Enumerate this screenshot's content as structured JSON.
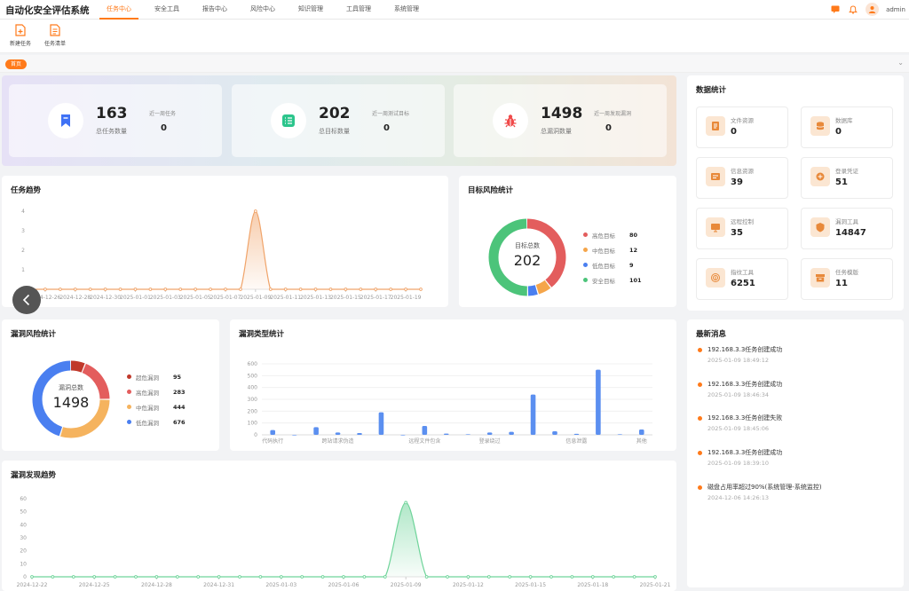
{
  "app": {
    "title": "自动化安全评估系统"
  },
  "nav": {
    "items": [
      "任务中心",
      "安全工具",
      "报告中心",
      "风险中心",
      "知识管理",
      "工具管理",
      "系统管理"
    ],
    "active": 0
  },
  "user": {
    "name": "admin"
  },
  "toolbar": {
    "new_task": "新建任务",
    "task_list": "任务清单"
  },
  "tabs": {
    "current": "首页"
  },
  "stats": [
    {
      "icon": "bookmark-icon",
      "value": "163",
      "label": "总任务数量",
      "sub_label": "近一周任务",
      "sub_value": "0",
      "color": "#3f72f5"
    },
    {
      "icon": "list-icon",
      "value": "202",
      "label": "总目标数量",
      "sub_label": "近一周测试目标",
      "sub_value": "0",
      "color": "#2cc58c"
    },
    {
      "icon": "bug-icon",
      "value": "1498",
      "label": "总漏洞数量",
      "sub_label": "近一周发现漏洞",
      "sub_value": "0",
      "color": "#f04a4a"
    }
  ],
  "data_stats": {
    "title": "数据统计",
    "items": [
      {
        "icon": "file-asset-icon",
        "label": "文件资源",
        "value": "0"
      },
      {
        "icon": "database-icon",
        "label": "数据库",
        "value": "0"
      },
      {
        "icon": "info-asset-icon",
        "label": "信息资源",
        "value": "39"
      },
      {
        "icon": "credential-icon",
        "label": "登录凭证",
        "value": "51"
      },
      {
        "icon": "remote-control-icon",
        "label": "远程控制",
        "value": "35"
      },
      {
        "icon": "vuln-tool-icon",
        "label": "漏洞工具",
        "value": "14847"
      },
      {
        "icon": "fingerprint-tool-icon",
        "label": "指纹工具",
        "value": "6251"
      },
      {
        "icon": "task-template-icon",
        "label": "任务模版",
        "value": "11"
      }
    ]
  },
  "messages": {
    "title": "最新消息",
    "items": [
      {
        "text": "192.168.3.3任务创建成功",
        "time": "2025-01-09 18:49:12"
      },
      {
        "text": "192.168.3.3任务创建成功",
        "time": "2025-01-09 18:46:34"
      },
      {
        "text": "192.168.3.3任务创建失败",
        "time": "2025-01-09 18:45:06"
      },
      {
        "text": "192.168.3.3任务创建成功",
        "time": "2025-01-09 18:39:10"
      },
      {
        "text": "磁盘占用率超过90%(系统管理-系统监控)",
        "time": "2024-12-06 14:26:13"
      }
    ]
  },
  "risk": {
    "title": "目标风险统计",
    "center_label": "目标总数",
    "center_value": "202",
    "items": [
      {
        "name": "高危目标",
        "value": 80,
        "color": "#e35d5d"
      },
      {
        "name": "中危目标",
        "value": 12,
        "color": "#f5a54a"
      },
      {
        "name": "低危目标",
        "value": 9,
        "color": "#4a7ff0"
      },
      {
        "name": "安全目标",
        "value": 101,
        "color": "#4cc47a"
      }
    ]
  },
  "vuln_risk": {
    "title": "漏洞风险统计",
    "center_label": "漏洞总数",
    "center_value": "1498",
    "items": [
      {
        "name": "超危漏洞",
        "value": 95,
        "color": "#c0392b"
      },
      {
        "name": "高危漏洞",
        "value": 283,
        "color": "#e35d5d"
      },
      {
        "name": "中危漏洞",
        "value": 444,
        "color": "#f5b35e"
      },
      {
        "name": "低危漏洞",
        "value": 676,
        "color": "#4a7ff0"
      }
    ]
  },
  "chart_data": [
    {
      "type": "line",
      "title": "任务趋势",
      "x_tick_labels": [
        "2024-12-26",
        "2024-12-28",
        "2024-12-30",
        "2025-01-01",
        "2025-01-03",
        "2025-01-05",
        "2025-01-07",
        "2025-01-09",
        "2025-01-11",
        "2025-01-13",
        "2025-01-15",
        "2025-01-17",
        "2025-01-19"
      ],
      "x": [
        "2024-12-25",
        "2024-12-26",
        "2024-12-27",
        "2024-12-28",
        "2024-12-29",
        "2024-12-30",
        "2024-12-31",
        "2025-01-01",
        "2025-01-02",
        "2025-01-03",
        "2025-01-04",
        "2025-01-05",
        "2025-01-06",
        "2025-01-07",
        "2025-01-08",
        "2025-01-09",
        "2025-01-10",
        "2025-01-11",
        "2025-01-12",
        "2025-01-13",
        "2025-01-14",
        "2025-01-15",
        "2025-01-16",
        "2025-01-17",
        "2025-01-18",
        "2025-01-19",
        "2025-01-20"
      ],
      "values": [
        0,
        0,
        0,
        0,
        0,
        0,
        0,
        0,
        0,
        0,
        0,
        0,
        0,
        0,
        0,
        4,
        0,
        0,
        0,
        0,
        0,
        0,
        0,
        0,
        0,
        0,
        0
      ],
      "ylim": [
        0,
        4
      ],
      "y_ticks": [
        0,
        1,
        2,
        3,
        4
      ],
      "color": "#f0a46a"
    },
    {
      "type": "bar",
      "title": "漏洞类型统计",
      "category_labels": [
        "代码执行",
        "跨站请求伪造",
        "远程文件包含",
        "登录绕过",
        "信息泄露",
        "其他"
      ],
      "values": [
        40,
        0,
        65,
        20,
        15,
        190,
        0,
        75,
        10,
        5,
        20,
        25,
        340,
        30,
        8,
        550,
        5,
        45
      ],
      "ylim": [
        0,
        600
      ],
      "y_ticks": [
        0,
        100,
        200,
        300,
        400,
        500,
        600
      ],
      "color": "#5b8ff0"
    },
    {
      "type": "area",
      "title": "漏洞发现趋势",
      "x_tick_labels": [
        "2024-12-22",
        "2024-12-25",
        "2024-12-28",
        "2024-12-31",
        "2025-01-03",
        "2025-01-06",
        "2025-01-09",
        "2025-01-12",
        "2025-01-15",
        "2025-01-18",
        "2025-01-21"
      ],
      "x": [
        "2024-12-22",
        "2024-12-23",
        "2024-12-24",
        "2024-12-25",
        "2024-12-26",
        "2024-12-27",
        "2024-12-28",
        "2024-12-29",
        "2024-12-30",
        "2024-12-31",
        "2025-01-01",
        "2025-01-02",
        "2025-01-03",
        "2025-01-04",
        "2025-01-05",
        "2025-01-06",
        "2025-01-07",
        "2025-01-08",
        "2025-01-09",
        "2025-01-10",
        "2025-01-11",
        "2025-01-12",
        "2025-01-13",
        "2025-01-14",
        "2025-01-15",
        "2025-01-16",
        "2025-01-17",
        "2025-01-18",
        "2025-01-19",
        "2025-01-20",
        "2025-01-21"
      ],
      "values": [
        0,
        0,
        0,
        0,
        0,
        0,
        0,
        0,
        0,
        0,
        0,
        0,
        0,
        0,
        0,
        0,
        0,
        0,
        57,
        0,
        0,
        0,
        0,
        0,
        0,
        0,
        0,
        0,
        0,
        0,
        0
      ],
      "ylim": [
        0,
        60
      ],
      "y_ticks": [
        0,
        10,
        20,
        30,
        40,
        50,
        60
      ],
      "color": "#6fd49a"
    }
  ]
}
